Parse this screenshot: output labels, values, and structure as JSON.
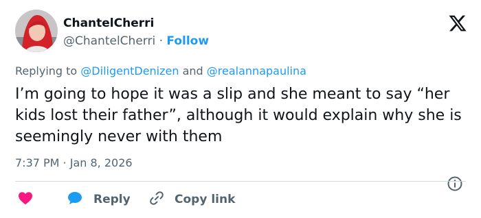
{
  "user": {
    "display_name": "ChantelCherri",
    "handle": "@ChantelCherri",
    "separator": " · ",
    "follow_label": "Follow"
  },
  "replying": {
    "prefix": "Replying to ",
    "mention1": "@DiligentDenizen",
    "joiner": " and ",
    "mention2": "@realannapaulina"
  },
  "tweet": {
    "text": "I’m going to hope it was a slip and she meant to say “her kids lost their father”, although it would explain why she is seemingly never with them",
    "timestamp": "7:37 PM · Jan 8, 2026"
  },
  "actions": {
    "reply_label": "Reply",
    "copy_label": "Copy link"
  },
  "icons": {
    "logo": "x-logo-icon",
    "like": "heart-icon",
    "reply": "speech-bubble-icon",
    "copy": "link-icon",
    "info": "info-icon"
  },
  "colors": {
    "accent": "#1d9bf0",
    "like": "#f91880",
    "muted": "#536471",
    "text": "#0f1419"
  }
}
